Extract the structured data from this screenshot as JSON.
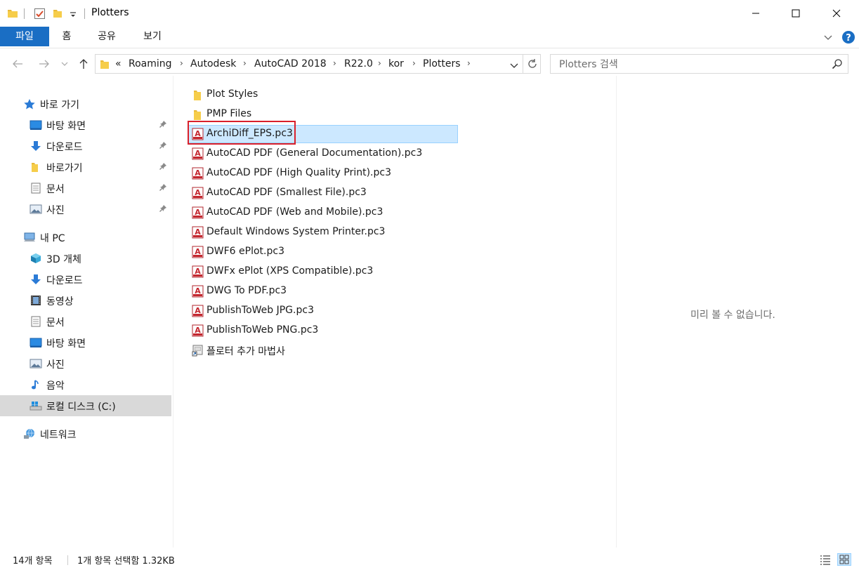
{
  "window": {
    "title": "Plotters"
  },
  "ribbon": {
    "tabs": [
      "파일",
      "홈",
      "공유",
      "보기"
    ]
  },
  "address": {
    "overflow": "«",
    "breadcrumbs": [
      "Roaming",
      "Autodesk",
      "AutoCAD 2018",
      "R22.0",
      "kor",
      "Plotters"
    ]
  },
  "search": {
    "placeholder": "Plotters 검색"
  },
  "nav": {
    "quick_access": "바로 가기",
    "quick_items": [
      "바탕 화면",
      "다운로드",
      "바로가기",
      "문서",
      "사진"
    ],
    "this_pc": "내 PC",
    "pc_items": [
      "3D 개체",
      "다운로드",
      "동영상",
      "문서",
      "바탕 화면",
      "사진",
      "음악",
      "로컬 디스크 (C:)"
    ],
    "network": "네트워크"
  },
  "files": [
    {
      "name": "Plot Styles",
      "type": "folder"
    },
    {
      "name": "PMP Files",
      "type": "folder"
    },
    {
      "name": "ArchiDiff_EPS.pc3",
      "type": "pc3",
      "selected": true
    },
    {
      "name": "AutoCAD PDF (General Documentation).pc3",
      "type": "pc3"
    },
    {
      "name": "AutoCAD PDF (High Quality Print).pc3",
      "type": "pc3"
    },
    {
      "name": "AutoCAD PDF (Smallest File).pc3",
      "type": "pc3"
    },
    {
      "name": "AutoCAD PDF (Web and Mobile).pc3",
      "type": "pc3"
    },
    {
      "name": "Default Windows System Printer.pc3",
      "type": "pc3"
    },
    {
      "name": "DWF6 ePlot.pc3",
      "type": "pc3"
    },
    {
      "name": "DWFx ePlot (XPS Compatible).pc3",
      "type": "pc3"
    },
    {
      "name": "DWG To PDF.pc3",
      "type": "pc3"
    },
    {
      "name": "PublishToWeb JPG.pc3",
      "type": "pc3"
    },
    {
      "name": "PublishToWeb PNG.pc3",
      "type": "pc3"
    },
    {
      "name": "플로터 추가 마법사",
      "type": "wizard"
    }
  ],
  "preview": {
    "message": "미리 볼 수 없습니다."
  },
  "status": {
    "item_count": "14개 항목",
    "selection": "1개 항목 선택함 1.32KB"
  },
  "colors": {
    "accent": "#1a6ec4",
    "selection": "#cce8ff",
    "highlight": "#d9202b"
  }
}
